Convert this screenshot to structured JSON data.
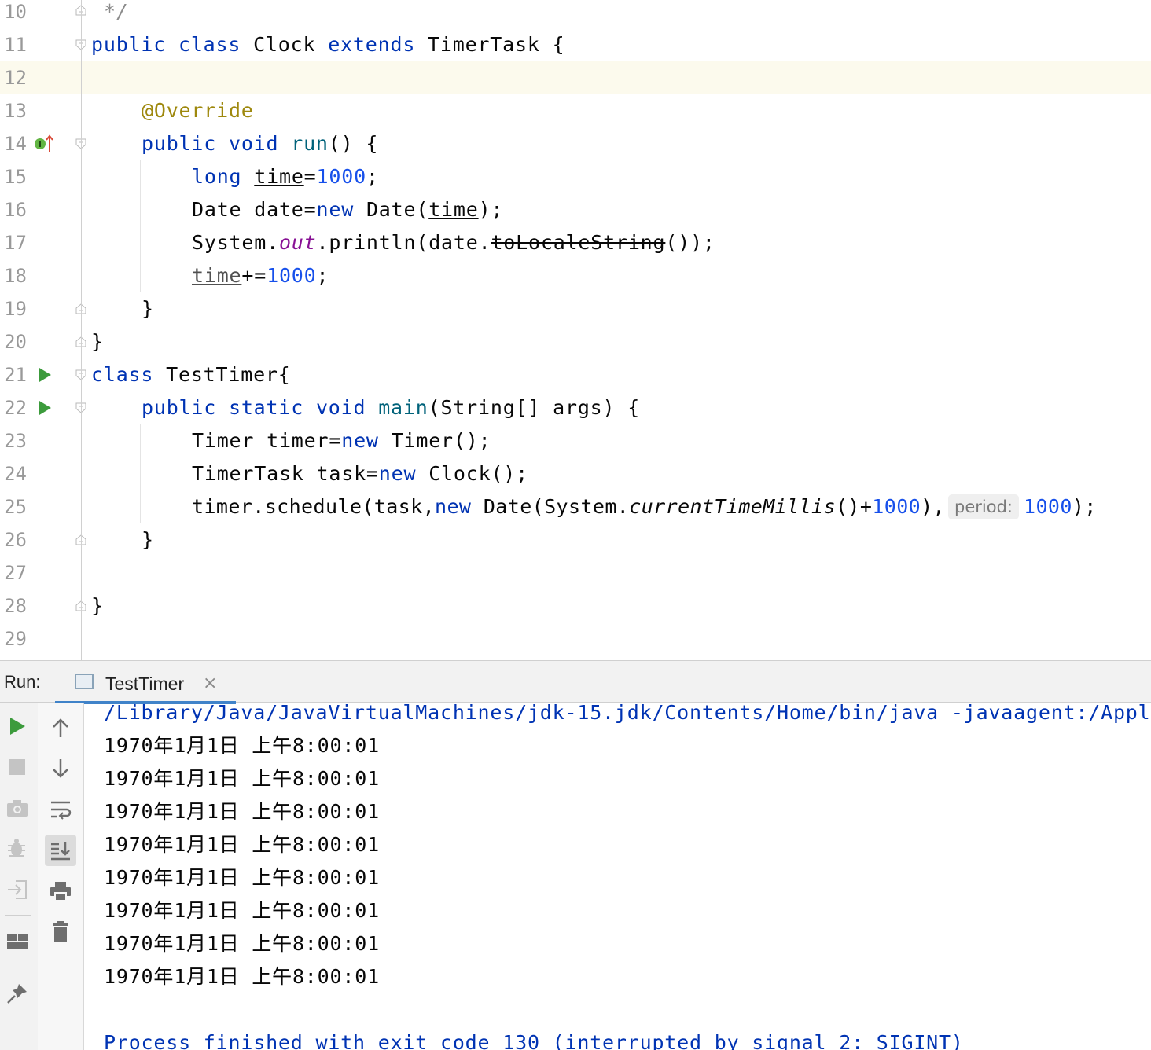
{
  "editor": {
    "line_numbers": [
      "10",
      "11",
      "12",
      "13",
      "14",
      "15",
      "16",
      "17",
      "18",
      "19",
      "20",
      "21",
      "22",
      "23",
      "24",
      "25",
      "26",
      "27",
      "28",
      "29"
    ],
    "tokens": {
      "l10_comment": "*/",
      "l11_public": "public",
      "l11_class": "class",
      "l11_name": "Clock",
      "l11_extends": "extends",
      "l11_super": "TimerTask",
      "l11_brace": "{",
      "l13_annotation": "@Override",
      "l14_public": "public",
      "l14_void": "void",
      "l14_name": "run",
      "l14_rest": "() {",
      "l15_long": "long",
      "l15_var": "time",
      "l15_eq": "=",
      "l15_num": "1000",
      "l15_semi": ";",
      "l16_type": "Date date=",
      "l16_new": "new",
      "l16_ctor": "Date(",
      "l16_var": "time",
      "l16_end": ");",
      "l17_sys": "System.",
      "l17_out": "out",
      "l17_mid": ".println(date.",
      "l17_deprecated": "toLocaleString",
      "l17_end": "());",
      "l18_var": "time",
      "l18_op": "+=",
      "l18_num": "1000",
      "l18_semi": ";",
      "l19_brace": "}",
      "l20_brace": "}",
      "l21_class": "class",
      "l21_name": "TestTimer{",
      "l22_public": "public",
      "l22_static": "static",
      "l22_void": "void",
      "l22_main": "main",
      "l22_params": "(String[] args) {",
      "l23_decl": "Timer timer=",
      "l23_new": "new",
      "l23_ctor": "Timer();",
      "l24_decl": "TimerTask task=",
      "l24_new": "new",
      "l24_ctor": "Clock();",
      "l25_call": "timer.schedule(task,",
      "l25_new": "new",
      "l25_date": "Date(System.",
      "l25_ctm": "currentTimeMillis",
      "l25_plus": "()+",
      "l25_num1": "1000",
      "l25_close": "),",
      "l25_hint": "period:",
      "l25_num2": "1000",
      "l25_end": ");",
      "l26_brace": "}",
      "l28_brace": "}"
    }
  },
  "run_panel": {
    "label": "Run:",
    "tab_label": "TestTimer",
    "tab_close": "×",
    "console": {
      "command": "/Library/Java/JavaVirtualMachines/jdk-15.jdk/Contents/Home/bin/java -javaagent:/Appl",
      "output": [
        "1970年1月1日 上午8:00:01",
        "1970年1月1日 上午8:00:01",
        "1970年1月1日 上午8:00:01",
        "1970年1月1日 上午8:00:01",
        "1970年1月1日 上午8:00:01",
        "1970年1月1日 上午8:00:01",
        "1970年1月1日 上午8:00:01",
        "1970年1月1日 上午8:00:01"
      ],
      "exit_message": "Process finished with exit code 130 (interrupted by signal 2: SIGINT)"
    },
    "toolbar_icons": [
      "rerun-icon",
      "stop-icon",
      "camera-icon",
      "debug-icon",
      "exit-icon",
      "layout-icon",
      "pin-icon",
      "scroll-up-icon",
      "scroll-down-icon",
      "soft-wrap-icon",
      "scroll-to-end-icon",
      "print-icon",
      "trash-icon"
    ]
  }
}
